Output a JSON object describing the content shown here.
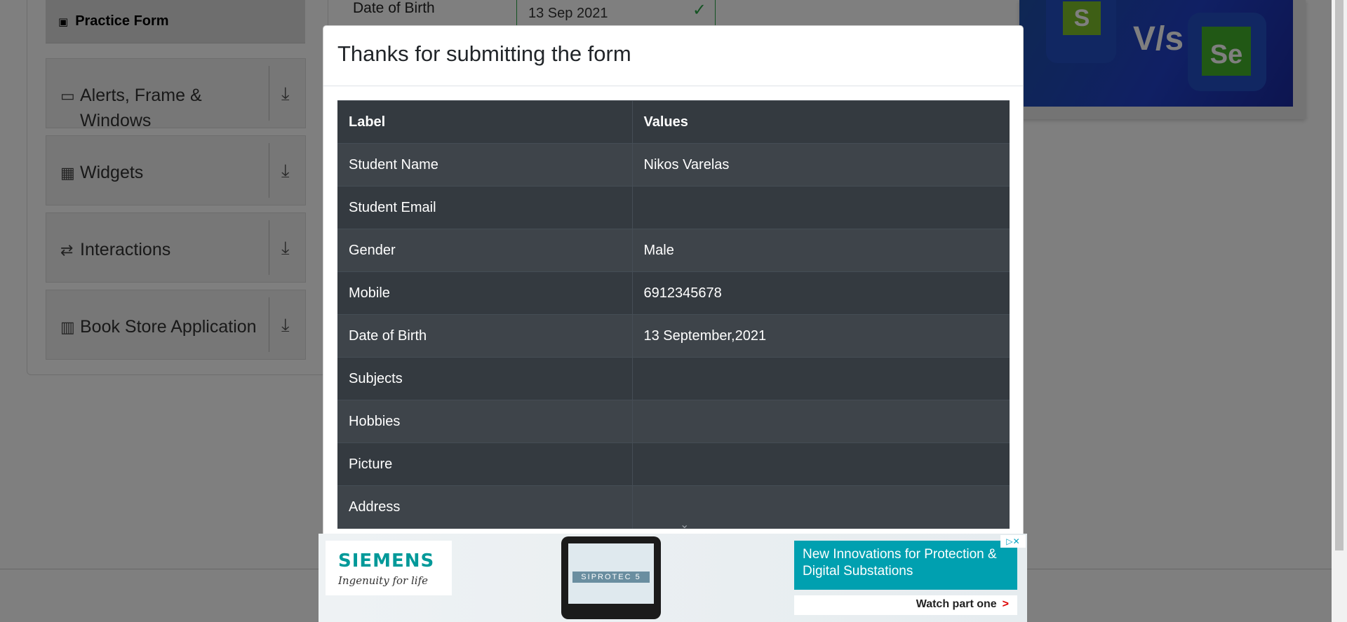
{
  "sidebar": {
    "active_item": "Practice Form",
    "groups": [
      {
        "label": "Alerts, Frame & Windows",
        "icon": "window-icon"
      },
      {
        "label": "Widgets",
        "icon": "widgets-icon"
      },
      {
        "label": "Interactions",
        "icon": "interactions-icon"
      },
      {
        "label": "Book Store Application",
        "icon": "books-icon"
      }
    ]
  },
  "form_background": {
    "dob_label": "Date of Birth",
    "dob_value": "13 Sep 2021"
  },
  "banner": {
    "left_tile": "S",
    "vs_text": "V/s",
    "right_tile": "Se"
  },
  "modal": {
    "title": "Thanks for submitting the form",
    "header": {
      "label": "Label",
      "value": "Values"
    },
    "rows": [
      {
        "label": "Student Name",
        "value": "Nikos Varelas"
      },
      {
        "label": "Student Email",
        "value": ""
      },
      {
        "label": "Gender",
        "value": "Male"
      },
      {
        "label": "Mobile",
        "value": "6912345678"
      },
      {
        "label": "Date of Birth",
        "value": "13 September,2021"
      },
      {
        "label": "Subjects",
        "value": ""
      },
      {
        "label": "Hobbies",
        "value": ""
      },
      {
        "label": "Picture",
        "value": ""
      },
      {
        "label": "Address",
        "value": ""
      }
    ]
  },
  "ad": {
    "brand": "SIEMENS",
    "tagline": "Ingenuity for life",
    "device_text": "SIPROTEC 5",
    "headline": "New Innovations for Protection & Digital Substations",
    "cta": "Watch part one",
    "cta_arrow": ">",
    "adchoices": "▷✕"
  }
}
